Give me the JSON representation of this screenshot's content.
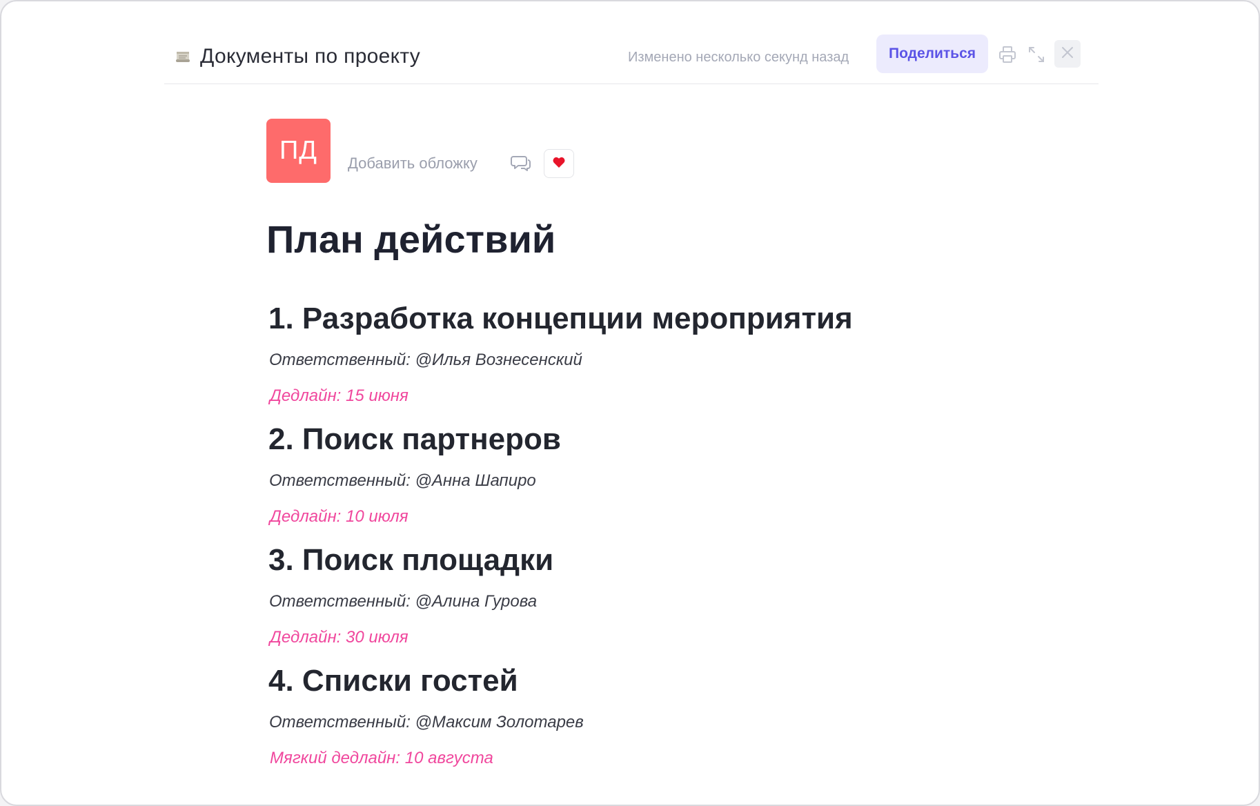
{
  "header": {
    "scroll_icon": "scroll-emoji-icon",
    "title": "Документы по проекту",
    "modified_text": "Изменено несколько секунд назад",
    "share_label": "Поделиться",
    "icons": [
      "printer-icon",
      "expand-icon",
      "close-icon"
    ]
  },
  "document": {
    "avatar_initials": "ПД",
    "avatar_color": "#fe6b6b",
    "add_cover_label": "Добавить обложку",
    "comment_icon": "comment-bubbles-icon",
    "reaction_icon": "heart-icon",
    "title": "План действий",
    "sections": [
      {
        "heading": "1. Разработка концепции мероприятия",
        "owner": "Ответственный: @Илья Вознесенский",
        "deadline": "Дедлайн: 15 июня"
      },
      {
        "heading": "2. Поиск партнеров",
        "owner": "Ответственный: @Анна Шапиро",
        "deadline": "Дедлайн: 10 июля"
      },
      {
        "heading": "3. Поиск площадки",
        "owner": "Ответственный: @Алина Гурова",
        "deadline": "Дедлайн: 30 июля"
      },
      {
        "heading": "4. Списки гостей",
        "owner": "Ответственный: @Максим Золотарев",
        "deadline": "Мягкий дедлайн: 10 августа"
      }
    ]
  },
  "colors": {
    "accent": "#5b53e6",
    "share_bg": "#ecebfd",
    "deadline": "#f0479d",
    "heading": "#23262f"
  }
}
